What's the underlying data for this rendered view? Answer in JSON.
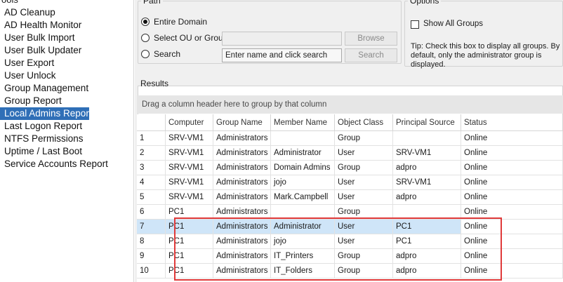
{
  "nav": {
    "heading": "ools",
    "items": [
      {
        "label": "AD Cleanup",
        "selected": false
      },
      {
        "label": "AD Health Monitor",
        "selected": false
      },
      {
        "label": "User Bulk Import",
        "selected": false
      },
      {
        "label": "User Bulk Updater",
        "selected": false
      },
      {
        "label": "User Export",
        "selected": false
      },
      {
        "label": "User Unlock",
        "selected": false
      },
      {
        "label": "Group Management",
        "selected": false
      },
      {
        "label": "Group Report",
        "selected": false
      },
      {
        "label": "Local Admins Report",
        "selected": true
      },
      {
        "label": "Last Logon Report",
        "selected": false
      },
      {
        "label": "NTFS Permissions",
        "selected": false
      },
      {
        "label": "Uptime / Last Boot",
        "selected": false
      },
      {
        "label": "Service Accounts Report",
        "selected": false
      }
    ]
  },
  "path": {
    "legend": "Path",
    "entire_domain": "Entire Domain",
    "select_ou": "Select OU or Group",
    "search": "Search",
    "ou_value": "",
    "search_value": "Enter name and click search",
    "browse_button": "Browse",
    "search_button": "Search",
    "selected_option": "entire_domain"
  },
  "options": {
    "legend": "Options",
    "show_all_groups": "Show All Groups",
    "show_all_checked": false,
    "tip": "Tip: Check this box to display all groups. By default, only the administrator group is displayed."
  },
  "results": {
    "label": "Results",
    "group_panel": "Drag a column header here to group by that column",
    "columns": [
      "Computer",
      "Group Name",
      "Member Name",
      "Object Class",
      "Principal Source",
      "Status"
    ],
    "rows": [
      [
        "1",
        "SRV-VM1",
        "Administrators",
        "",
        "Group",
        "",
        "Online"
      ],
      [
        "2",
        "SRV-VM1",
        "Administrators",
        "Administrator",
        "User",
        "SRV-VM1",
        "Online"
      ],
      [
        "3",
        "SRV-VM1",
        "Administrators",
        "Domain Admins",
        "Group",
        "adpro",
        "Online"
      ],
      [
        "4",
        "SRV-VM1",
        "Administrators",
        "jojo",
        "User",
        "SRV-VM1",
        "Online"
      ],
      [
        "5",
        "SRV-VM1",
        "Administrators",
        "Mark.Campbell",
        "User",
        "adpro",
        "Online"
      ],
      [
        "6",
        "PC1",
        "Administrators",
        "",
        "Group",
        "",
        "Online"
      ],
      [
        "7",
        "PC1",
        "Administrators",
        "Administrator",
        "User",
        "PC1",
        "Online"
      ],
      [
        "8",
        "PC1",
        "Administrators",
        "jojo",
        "User",
        "PC1",
        "Online"
      ],
      [
        "9",
        "PC1",
        "Administrators",
        "IT_Printers",
        "Group",
        "adpro",
        "Online"
      ],
      [
        "10",
        "PC1",
        "Administrators",
        "IT_Folders",
        "Group",
        "adpro",
        "Online"
      ]
    ],
    "selected_row": 7
  },
  "colors": {
    "selected_nav": "#2f6fb7",
    "selected_row": "#cfe5f8",
    "highlight_border": "#e03a3a"
  }
}
